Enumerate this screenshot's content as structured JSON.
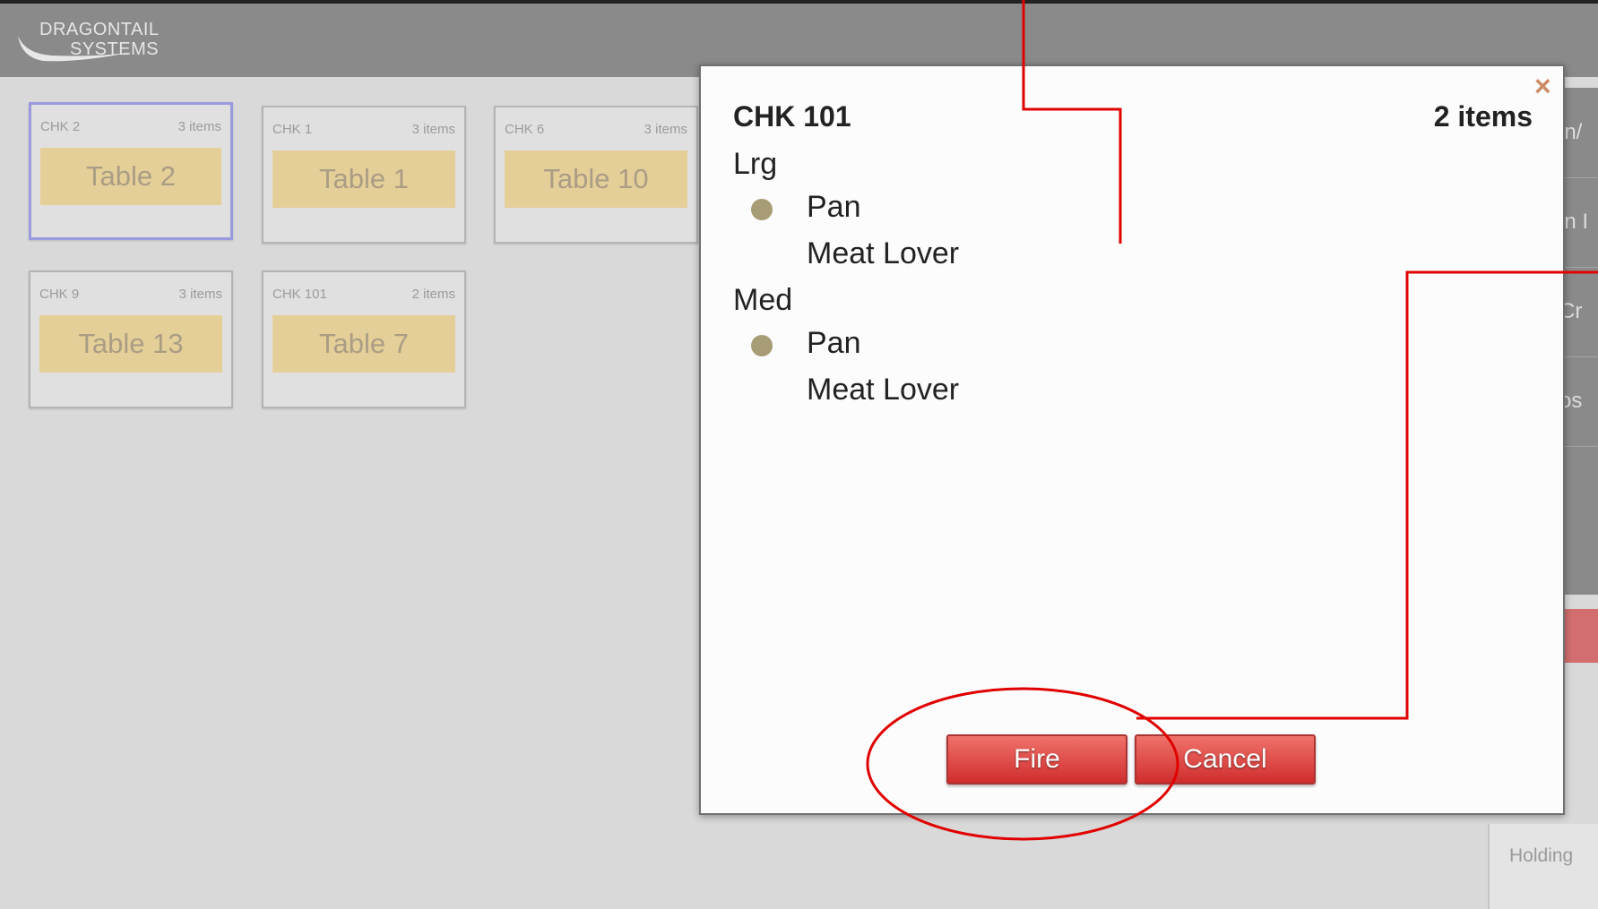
{
  "header": {
    "logo_line1": "DRAGONTAIL",
    "logo_line2": "SYSTEMS"
  },
  "checks": [
    {
      "chk": "CHK 2",
      "items": "3 items",
      "table": "Table 2",
      "selected": true
    },
    {
      "chk": "CHK 1",
      "items": "3 items",
      "table": "Table 1",
      "selected": false
    },
    {
      "chk": "CHK 6",
      "items": "3 items",
      "table": "Table 10",
      "selected": false
    },
    {
      "chk": "CHK 9",
      "items": "3 items",
      "table": "Table 13",
      "selected": false
    },
    {
      "chk": "CHK 101",
      "items": "2 items",
      "table": "Table 7",
      "selected": false
    }
  ],
  "right_panel": {
    "items": [
      "in/",
      "in I",
      "Cr",
      "os"
    ],
    "holding_label": "Holding"
  },
  "modal": {
    "title": "CHK 101",
    "count": "2 items",
    "close_icon": "close-icon",
    "groups": [
      {
        "size": "Lrg",
        "crust": "Pan",
        "pizza": "Meat Lover"
      },
      {
        "size": "Med",
        "crust": "Pan",
        "pizza": "Meat Lover"
      }
    ],
    "fire_label": "Fire",
    "cancel_label": "Cancel"
  },
  "colors": {
    "accent_red": "#d63a3a",
    "annotation_red": "#e00000",
    "table_band": "#e5cf98",
    "bullet": "#a89c76"
  }
}
